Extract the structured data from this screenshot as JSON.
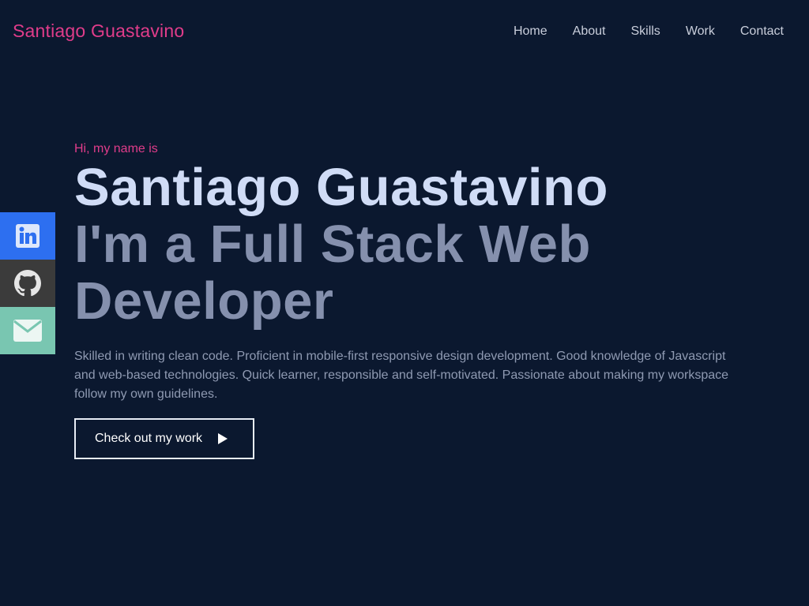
{
  "header": {
    "logo": "Santiago Guastavino",
    "nav": [
      "Home",
      "About",
      "Skills",
      "Work",
      "Contact"
    ]
  },
  "hero": {
    "greeting": "Hi, my name is",
    "name": "Santiago Guastavino",
    "role": "I'm a Full Stack Web Developer",
    "bio": "Skilled in writing clean code. Proficient in mobile-first responsive design development. Good knowledge of Javascript and web-based technologies. Quick learner, responsible and self-motivated. Passionate about making my workspace follow my own guidelines.",
    "cta_label": "Check out my work"
  },
  "social": [
    {
      "name": "linkedin",
      "icon": "linkedin-icon",
      "color": "#2d6ff0"
    },
    {
      "name": "github",
      "icon": "github-icon",
      "color": "#3b3b3b"
    },
    {
      "name": "mail",
      "icon": "mail-icon",
      "color": "#79c6b1"
    }
  ],
  "colors": {
    "background": "#0b182f",
    "accent": "#e03c8a",
    "name": "#d0dcf6",
    "role": "#8590ad",
    "body_text": "#8f9ab2"
  }
}
